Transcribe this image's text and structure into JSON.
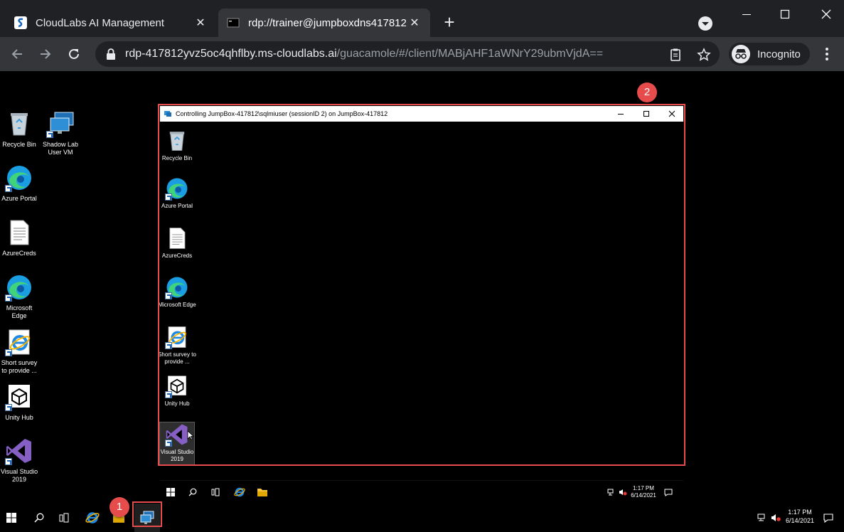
{
  "browser": {
    "tabs": [
      {
        "title": "CloudLabs AI Management",
        "close": "✕",
        "active": false
      },
      {
        "title": "rdp://trainer@jumpboxdns417812",
        "close": "✕",
        "active": true
      }
    ],
    "new_tab": "+",
    "window_controls": {
      "minimize": "—",
      "maximize": "☐",
      "close": "✕"
    },
    "address_bar": {
      "host": "rdp-417812yvz5oc4qhflby.ms-cloudlabs.ai",
      "path": "/guacamole/#/client/MABjAHF1aWNrY29ubmVjdA=="
    },
    "profile_label": "Incognito"
  },
  "desktop": {
    "icons": [
      {
        "label": "Recycle Bin",
        "icon": "recycle-bin-icon"
      },
      {
        "label": "Shadow Lab User VM",
        "icon": "remote-desktop-icon"
      },
      {
        "label": "Azure Portal",
        "icon": "edge-icon"
      },
      {
        "label": "AzureCreds",
        "icon": "text-file-icon"
      },
      {
        "label": "Microsoft Edge",
        "icon": "edge-icon"
      },
      {
        "label": "Short survey to provide ...",
        "icon": "internet-explorer-icon"
      },
      {
        "label": "Unity Hub",
        "icon": "unity-icon"
      },
      {
        "label": "Visual Studio 2019",
        "icon": "visual-studio-icon"
      }
    ]
  },
  "rdp_window": {
    "title": "Controlling JumpBox-417812\\sqlmiuser (sessionID 2) on JumpBox-417812",
    "controls": {
      "minimize": "—",
      "maximize": "☐",
      "close": "✕"
    },
    "icons": [
      {
        "label": "Recycle Bin",
        "icon": "recycle-bin-icon"
      },
      {
        "label": "Azure Portal",
        "icon": "edge-icon"
      },
      {
        "label": "AzureCreds",
        "icon": "text-file-icon"
      },
      {
        "label": "Microsoft Edge",
        "icon": "edge-icon"
      },
      {
        "label": "Short survey to provide ...",
        "icon": "internet-explorer-icon"
      },
      {
        "label": "Unity Hub",
        "icon": "unity-icon"
      },
      {
        "label": "Visual Studio 2019",
        "icon": "visual-studio-icon",
        "selected": true
      }
    ],
    "taskbar_clock": {
      "time": "1:17 PM",
      "date": "6/14/2021"
    }
  },
  "taskbar": {
    "clock": {
      "time": "1:17 PM",
      "date": "6/14/2021"
    }
  },
  "annotations": [
    {
      "number": "1",
      "target": "taskbar remote desktop shadow app"
    },
    {
      "number": "2",
      "target": "RDP window maximize button"
    }
  ],
  "colors": {
    "highlight": "#e74c4c",
    "chrome_dark": "#202124",
    "chrome_toolbar": "#35363a",
    "edge_blue": "#1b9de2",
    "vs_purple": "#865fc5"
  }
}
